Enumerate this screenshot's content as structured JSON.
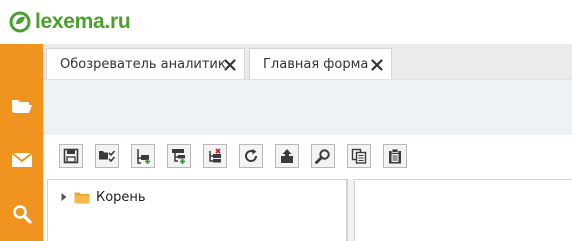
{
  "brand": {
    "logo_text": "lexema.ru",
    "logo_color": "#4aa02c",
    "sidebar_color": "#f0941f"
  },
  "sidebar": {
    "items": [
      {
        "icon": "folder-open-icon"
      },
      {
        "icon": "envelope-icon"
      },
      {
        "icon": "search-icon"
      }
    ]
  },
  "tabs": [
    {
      "label": "Обозреватель аналитик",
      "active": true
    },
    {
      "label": "Главная форма",
      "active": true
    }
  ],
  "toolbar": {
    "buttons": [
      {
        "icon": "save-icon"
      },
      {
        "icon": "select-items-icon"
      },
      {
        "icon": "add-item-icon"
      },
      {
        "icon": "add-child-icon"
      },
      {
        "icon": "delete-item-icon"
      },
      {
        "icon": "refresh-icon"
      },
      {
        "icon": "export-icon"
      },
      {
        "icon": "find-icon"
      },
      {
        "icon": "copy-icon"
      },
      {
        "icon": "paste-icon"
      }
    ]
  },
  "tree": {
    "root": {
      "label": "Корень",
      "icon": "folder-icon",
      "expanded": false
    }
  }
}
